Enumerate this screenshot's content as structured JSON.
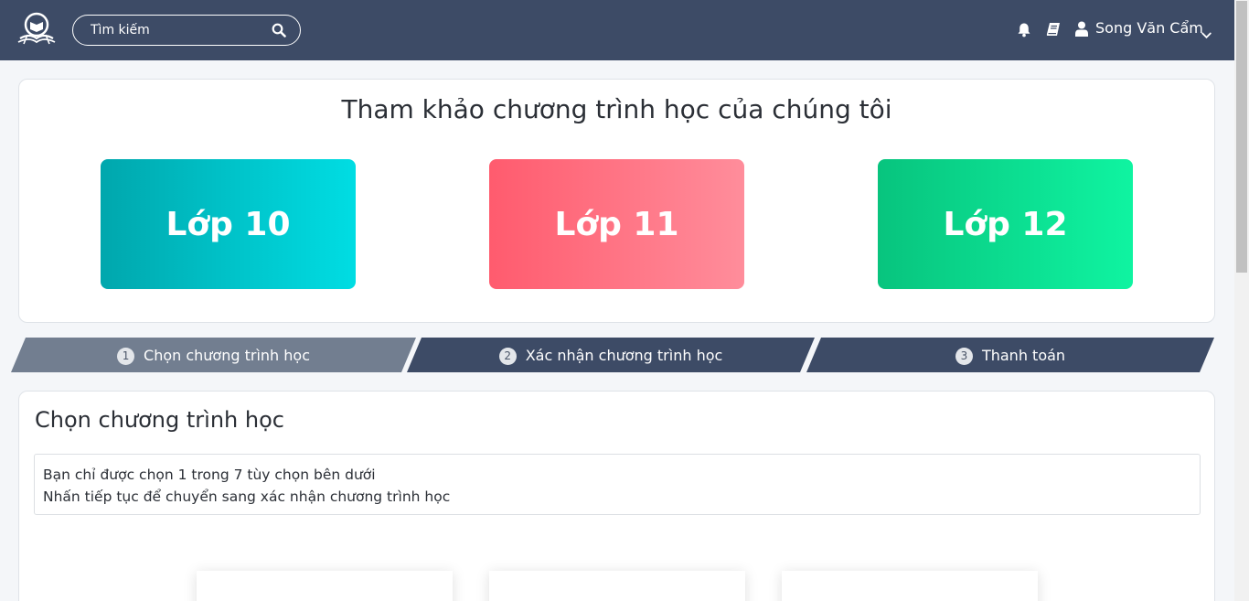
{
  "header": {
    "search_placeholder": "Tìm kiếm",
    "user_name": "Song Văn Cẩm",
    "icons": [
      "logo-icon",
      "search-icon",
      "bell-icon",
      "book-icon",
      "user-icon",
      "chevron-down-icon"
    ]
  },
  "programs": {
    "title": "Tham khảo chương trình học của chúng tôi",
    "grades": [
      {
        "label": "Lớp 10",
        "color_from": "#00a7ad",
        "color_to": "#00dde3"
      },
      {
        "label": "Lớp 11",
        "color_from": "#ff5b6e",
        "color_to": "#ff8d9b"
      },
      {
        "label": "Lớp 12",
        "color_from": "#08c47e",
        "color_to": "#0ff4a1"
      }
    ]
  },
  "steps": [
    {
      "num": "1",
      "label": "Chọn chương trình học",
      "active": true
    },
    {
      "num": "2",
      "label": "Xác nhận chương trình học",
      "active": false
    },
    {
      "num": "3",
      "label": "Thanh toán",
      "active": false
    }
  ],
  "choose": {
    "title": "Chọn chương trình học",
    "info_line1": "Bạn chỉ được chọn 1 trong 7 tùy chọn bên dưới",
    "info_line2": "Nhấn tiếp tục để chuyển sang xác nhận chương trình học"
  },
  "colors": {
    "navbar": "#3d4b66",
    "step_active": "#727e90",
    "step_inactive": "#3d4b66",
    "page_bg": "#f4f6f9"
  }
}
